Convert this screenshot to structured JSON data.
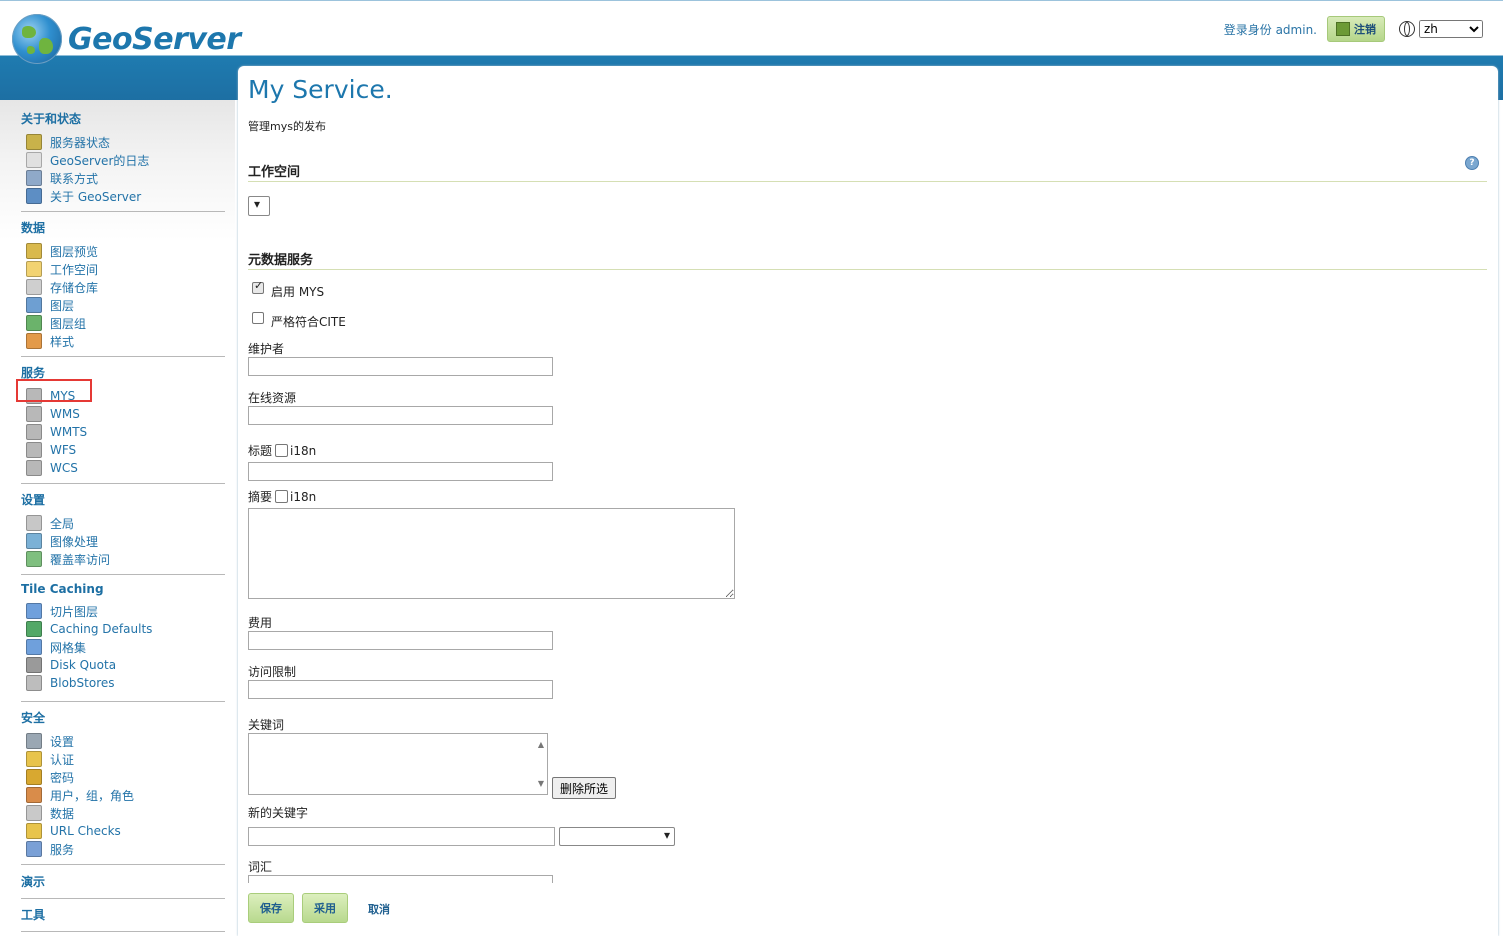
{
  "header": {
    "brand": "GeoServer",
    "logged_in_as": "登录身份 admin.",
    "logout_label": "注销",
    "language": "zh"
  },
  "sidebar": {
    "groups": [
      {
        "title": "关于和状态",
        "items": [
          {
            "label": "服务器状态",
            "icon": "server-status-icon"
          },
          {
            "label": "GeoServer的日志",
            "icon": "log-icon"
          },
          {
            "label": "联系方式",
            "icon": "contact-icon"
          },
          {
            "label": "关于 GeoServer",
            "icon": "help-icon"
          }
        ]
      },
      {
        "title": "数据",
        "items": [
          {
            "label": "图层预览",
            "icon": "layer-preview-icon"
          },
          {
            "label": "工作空间",
            "icon": "folder-icon"
          },
          {
            "label": "存储仓库",
            "icon": "store-icon"
          },
          {
            "label": "图层",
            "icon": "layer-icon"
          },
          {
            "label": "图层组",
            "icon": "layer-group-icon"
          },
          {
            "label": "样式",
            "icon": "style-icon"
          }
        ]
      },
      {
        "title": "服务",
        "items": [
          {
            "label": "MYS",
            "icon": "service-icon"
          },
          {
            "label": "WMS",
            "icon": "service-icon"
          },
          {
            "label": "WMTS",
            "icon": "service-icon"
          },
          {
            "label": "WFS",
            "icon": "service-icon"
          },
          {
            "label": "WCS",
            "icon": "service-icon"
          }
        ]
      },
      {
        "title": "设置",
        "items": [
          {
            "label": "全局",
            "icon": "global-icon"
          },
          {
            "label": "图像处理",
            "icon": "image-processing-icon"
          },
          {
            "label": "覆盖率访问",
            "icon": "coverage-access-icon"
          }
        ]
      },
      {
        "title": "Tile Caching",
        "items": [
          {
            "label": "切片图层",
            "icon": "tile-layers-icon"
          },
          {
            "label": "Caching Defaults",
            "icon": "caching-defaults-icon"
          },
          {
            "label": "网格集",
            "icon": "gridset-icon"
          },
          {
            "label": "Disk Quota",
            "icon": "disk-quota-icon"
          },
          {
            "label": "BlobStores",
            "icon": "blobstore-icon"
          }
        ]
      },
      {
        "title": "安全",
        "items": [
          {
            "label": "设置",
            "icon": "key-icon"
          },
          {
            "label": "认证",
            "icon": "shield-icon"
          },
          {
            "label": "密码",
            "icon": "lock-icon"
          },
          {
            "label": "用户，组，角色",
            "icon": "users-icon"
          },
          {
            "label": "数据",
            "icon": "data-security-icon"
          },
          {
            "label": "URL Checks",
            "icon": "shield-icon"
          },
          {
            "label": "服务",
            "icon": "service-security-icon"
          }
        ]
      },
      {
        "title": "演示",
        "items": []
      },
      {
        "title": "工具",
        "items": []
      }
    ]
  },
  "main": {
    "title": "My Service.",
    "subtitle": "管理mys的发布",
    "workspace_section": "工作空间",
    "metadata_section": "元数据服务",
    "enable_label": "启用 MYS",
    "cite_label": "严格符合CITE",
    "fields": {
      "maintainer": "维护者",
      "online_resource": "在线资源",
      "title": "标题",
      "abstract": "摘要",
      "i18n": "i18n",
      "fees": "费用",
      "access_constraints": "访问限制",
      "keywords": "关键词",
      "new_keyword": "新的关键字",
      "vocabulary": "词汇"
    },
    "delete_selected": "删除所选",
    "buttons": {
      "save": "保存",
      "apply": "采用",
      "cancel": "取消"
    }
  },
  "colors": {
    "header_blue": "#1f7bb0",
    "link_blue": "#2373a8",
    "button_green": "#b8d98e",
    "highlight_red": "#e53935"
  }
}
